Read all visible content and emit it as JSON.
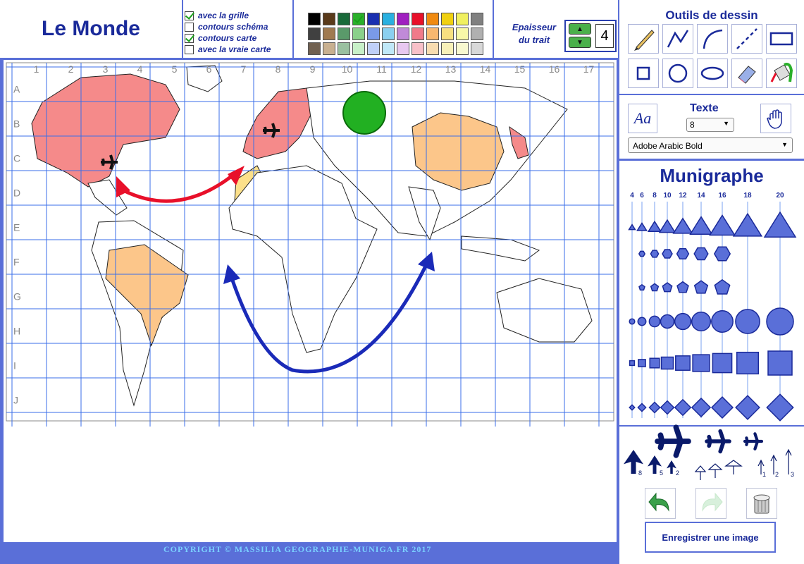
{
  "title": "Le Monde",
  "options": [
    {
      "label": "avec la grille",
      "checked": true
    },
    {
      "label": "contours schéma",
      "checked": false
    },
    {
      "label": "contours carte",
      "checked": true
    },
    {
      "label": "avec la vraie carte",
      "checked": false
    }
  ],
  "palette": {
    "colors": [
      "#000000",
      "#5a3a1a",
      "#1a6a3a",
      "#2ab02a",
      "#1a30b0",
      "#2ab0e0",
      "#a020c0",
      "#e8102a",
      "#f08a10",
      "#f0d010",
      "#f0f060",
      "#808080",
      "#404040",
      "#a07a50",
      "#5a9a6a",
      "#8ad08a",
      "#7a9ae8",
      "#8ad0f0",
      "#c08ad8",
      "#f07a8a",
      "#f8b870",
      "#f8e080",
      "#f8f8a8",
      "#b0b0b0",
      "#706050",
      "#c8b090",
      "#9ac0a0",
      "#c8f0c8",
      "#c0d0f8",
      "#c0e8f8",
      "#e8c8f0",
      "#f8c0c8",
      "#f8dcb0",
      "#f8f0b8",
      "#f8f8d0",
      "#d8d8d8"
    ],
    "selected_index": 3
  },
  "thickness": {
    "label_line1": "Epaisseur",
    "label_line2": "du trait",
    "value": "4"
  },
  "tools": {
    "heading": "Outils de dessin",
    "names": [
      "pencil-icon",
      "polyline-icon",
      "curve-icon",
      "dashed-line-icon",
      "rectangle-icon",
      "square-icon",
      "circle-icon",
      "ellipse-icon",
      "eraser-icon",
      "fill-bucket-icon"
    ]
  },
  "texte": {
    "heading": "Texte",
    "size_value": "8",
    "font_value": "Adobe Arabic Bold",
    "text_tool_glyph": "Aa"
  },
  "munigraphe": {
    "heading": "Munigraphe",
    "sizes": [
      "4",
      "6",
      "8",
      "10",
      "12",
      "14",
      "16",
      "18",
      "20"
    ],
    "arrow_labels": [
      "8",
      "5",
      "2",
      "1",
      "2",
      "3"
    ]
  },
  "save_label": "Enregistrer une image",
  "copyright": "COPYRIGHT © MASSILIA GEOGRAPHIE-MUNIGA.FR 2017",
  "grid": {
    "columns": [
      "1",
      "2",
      "3",
      "4",
      "5",
      "6",
      "7",
      "8",
      "9",
      "10",
      "11",
      "12",
      "13",
      "14",
      "15",
      "16",
      "17"
    ],
    "rows": [
      "A",
      "B",
      "C",
      "D",
      "E",
      "F",
      "G",
      "H",
      "I",
      "J"
    ]
  }
}
